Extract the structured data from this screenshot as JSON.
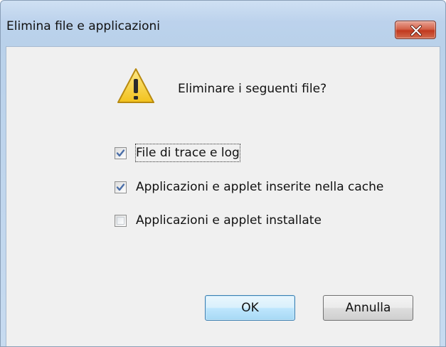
{
  "window": {
    "title": "Elimina file e applicazioni",
    "close_icon": "close-icon"
  },
  "dialog": {
    "icon": "warning-icon",
    "question": "Eliminare i seguenti file?",
    "checkboxes": [
      {
        "label": "File di trace e log",
        "checked": true,
        "focused": true
      },
      {
        "label": "Applicazioni e applet inserite nella cache",
        "checked": true,
        "focused": false
      },
      {
        "label": "Applicazioni e applet installate",
        "checked": false,
        "focused": false
      }
    ]
  },
  "buttons": {
    "ok_label": "OK",
    "cancel_label": "Annulla",
    "default": "ok"
  },
  "colors": {
    "close_button": "#c9452b",
    "default_button_border": "#3c7fb1",
    "checkmark": "#4a6ea8",
    "warning_fill": "#f7d23c"
  }
}
